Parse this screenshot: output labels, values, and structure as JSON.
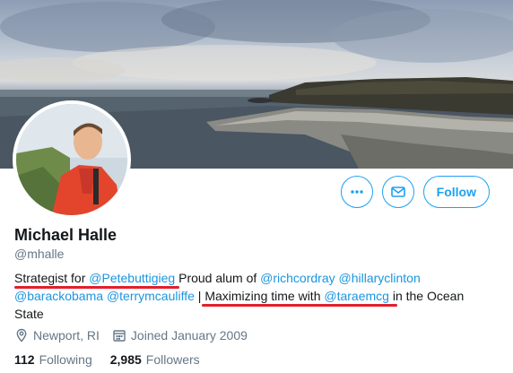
{
  "profile": {
    "name": "Michael Halle",
    "handle": "@mhalle",
    "bio": {
      "p1": "Strategist for ",
      "m1": "@Petebuttigieg",
      "p2": " Proud alum of ",
      "m2": "@richcordray",
      "m3": "@hillaryclinton",
      "m4": "@barackobama",
      "m5": "@terrymcauliffe",
      "p3": " | Maximizing time with ",
      "m6": "@taraemcg",
      "p4": " in the Ocean State"
    },
    "location": "Newport, RI",
    "joined": "Joined January 2009",
    "following_count": "112",
    "following_label": "Following",
    "followers_count": "2,985",
    "followers_label": "Followers"
  },
  "actions": {
    "follow_label": "Follow"
  },
  "icons": {
    "more": "more-icon",
    "message": "envelope-icon",
    "location": "location-pin-icon",
    "calendar": "calendar-icon"
  },
  "colors": {
    "accent": "#1da1f2",
    "mention": "#1b95e0",
    "secondary_text": "#657786",
    "annotation_red": "#e1202c"
  }
}
